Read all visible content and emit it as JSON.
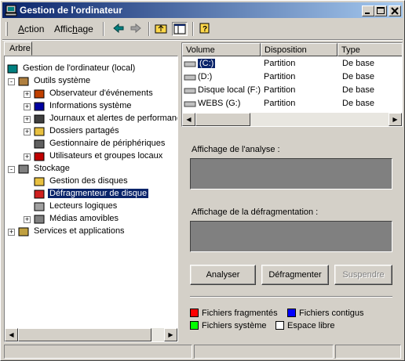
{
  "window": {
    "title": "Gestion de l'ordinateur",
    "controls": [
      "minimize",
      "maximize",
      "close"
    ]
  },
  "menubar": {
    "items": [
      {
        "label": "Action",
        "accel": "A",
        "rest": "ction"
      },
      {
        "label": "Affichage",
        "accel": "h",
        "pre": "Affic",
        "rest": "age"
      }
    ],
    "toolbar_icons": [
      "back-arrow-icon",
      "forward-arrow-icon",
      "up-folder-icon",
      "show-hide-tree-icon",
      "help-icon"
    ]
  },
  "tree": {
    "tab_label": "Arbre",
    "nodes": [
      {
        "label": "Gestion de l'ordinateur (local)",
        "level": 0,
        "expander": "",
        "icon": "computer-icon"
      },
      {
        "label": "Outils système",
        "level": 1,
        "expander": "-",
        "icon": "tools-icon"
      },
      {
        "label": "Observateur d'événements",
        "level": 2,
        "expander": "+",
        "icon": "event-viewer-icon"
      },
      {
        "label": "Informations système",
        "level": 2,
        "expander": "+",
        "icon": "system-info-icon"
      },
      {
        "label": "Journaux et alertes de performance",
        "level": 2,
        "expander": "+",
        "icon": "performance-icon"
      },
      {
        "label": "Dossiers partagés",
        "level": 2,
        "expander": "+",
        "icon": "shared-folder-icon"
      },
      {
        "label": "Gestionnaire de périphériques",
        "level": 2,
        "expander": "",
        "icon": "device-manager-icon"
      },
      {
        "label": "Utilisateurs et groupes locaux",
        "level": 2,
        "expander": "+",
        "icon": "users-icon"
      },
      {
        "label": "Stockage",
        "level": 1,
        "expander": "-",
        "icon": "storage-icon"
      },
      {
        "label": "Gestion des disques",
        "level": 2,
        "expander": "",
        "icon": "disk-management-icon"
      },
      {
        "label": "Défragmenteur de disque",
        "level": 2,
        "expander": "",
        "icon": "defragmenter-icon",
        "selected": true
      },
      {
        "label": "Lecteurs logiques",
        "level": 2,
        "expander": "",
        "icon": "logical-drive-icon"
      },
      {
        "label": "Médias amovibles",
        "level": 2,
        "expander": "+",
        "icon": "removable-media-icon"
      },
      {
        "label": "Services et applications",
        "level": 1,
        "expander": "+",
        "icon": "services-icon"
      }
    ]
  },
  "volumes": {
    "columns": [
      "Volume",
      "Disposition",
      "Type"
    ],
    "rows": [
      {
        "volume": "(C:)",
        "layout": "Partition",
        "type": "De base",
        "selected": true
      },
      {
        "volume": "(D:)",
        "layout": "Partition",
        "type": "De base"
      },
      {
        "volume": "Disque local (F:)",
        "layout": "Partition",
        "type": "De base"
      },
      {
        "volume": "WEBS (G:)",
        "layout": "Partition",
        "type": "De base"
      }
    ]
  },
  "analysis": {
    "label": "Affichage de l'analyse :"
  },
  "defrag": {
    "label": "Affichage de la défragmentation :"
  },
  "buttons": {
    "analyze": "Analyser",
    "defragment": "Défragmenter",
    "suspend": "Suspendre"
  },
  "legend": [
    {
      "label": "Fichiers fragmentés",
      "color": "#ff0000"
    },
    {
      "label": "Fichiers contigus",
      "color": "#0000ff"
    },
    {
      "label": "Fichiers système",
      "color": "#00ff00"
    },
    {
      "label": "Espace libre",
      "color": "#ffffff"
    }
  ]
}
